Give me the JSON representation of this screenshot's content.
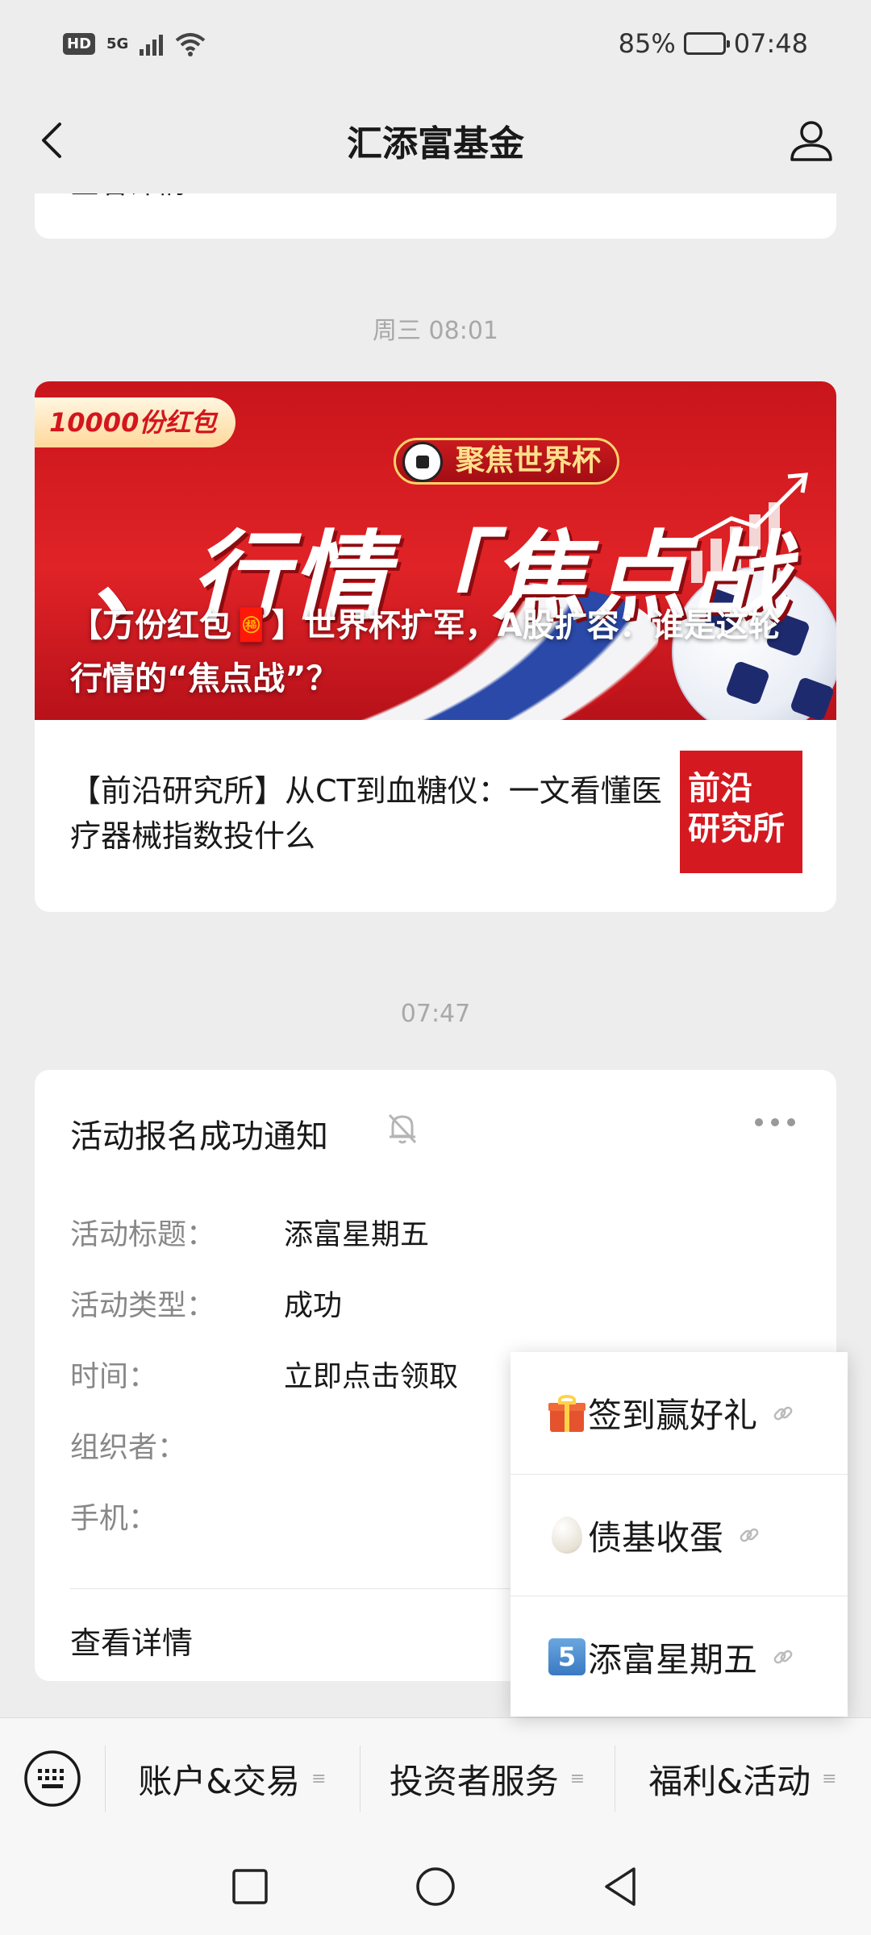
{
  "status_bar": {
    "hd": "HD",
    "net": "5G",
    "battery": "85%",
    "time": "07:48",
    "battery_level": 0.85
  },
  "nav": {
    "title": "汇添富基金"
  },
  "messages": {
    "partial_card_text": "查看详情",
    "timestamp_1": "周三 08:01",
    "news_banner": {
      "tag": "10000份红包",
      "cup_tag": "聚焦世界杯",
      "big_title": "、行情「焦点战",
      "caption": "【万份红包🧧】世界杯扩军，A股扩容：谁是这轮行情的“焦点战”？"
    },
    "news_item": {
      "text": "【前沿研究所】从CT到血糖仪：一文看懂医疗器械指数投什么",
      "thumb_line1": "前沿",
      "thumb_line2": "研究所"
    },
    "timestamp_2": "07:47",
    "notice": {
      "title": "活动报名成功通知",
      "fields": [
        {
          "key": "活动标题：",
          "value": "添富星期五"
        },
        {
          "key": "活动类型：",
          "value": "成功"
        },
        {
          "key": "时间：",
          "value": "立即点击领取"
        },
        {
          "key": "组织者：",
          "value": ""
        },
        {
          "key": "手机：",
          "value": ""
        }
      ],
      "detail": "查看详情"
    }
  },
  "popup": {
    "items": [
      {
        "icon": "gift-icon",
        "label": "签到赢好礼"
      },
      {
        "icon": "egg-icon",
        "label": "债基收蛋"
      },
      {
        "icon": "keycap-five-icon",
        "label": "添富星期五"
      }
    ]
  },
  "menu_bar": {
    "items": [
      "账户&交易",
      "投资者服务",
      "福利&活动"
    ]
  }
}
